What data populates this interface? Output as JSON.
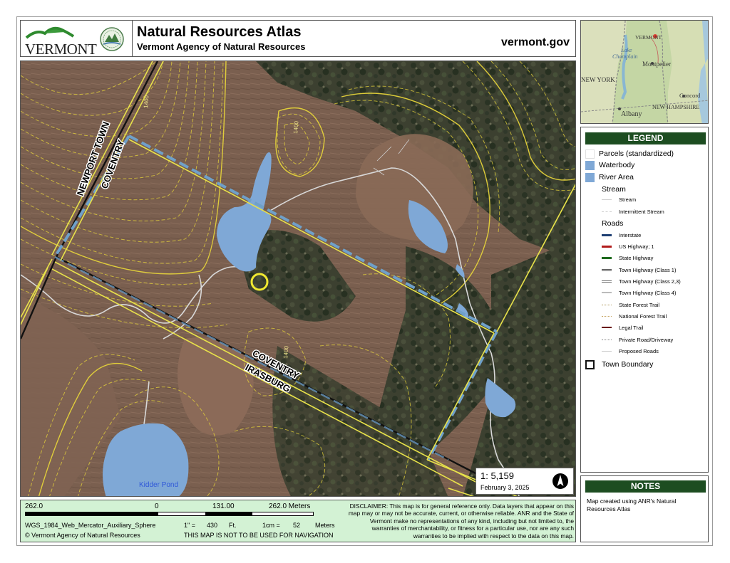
{
  "header": {
    "logo_text": "VERMONT",
    "title": "Natural Resources Atlas",
    "subtitle": "Vermont Agency of Natural Resources",
    "site": "vermont.gov"
  },
  "map": {
    "town_labels": {
      "newport": "NEWPORT TOWN",
      "coventry_north": "COVENTRY",
      "coventry_south": "COVENTRY",
      "irasburg": "IRASBURG"
    },
    "pond_label": "Kidder Pond",
    "contour_labels": [
      "1400",
      "1400",
      "1400"
    ],
    "scale_ratio": "1:  5,159",
    "date": "February 3, 2025",
    "colors": {
      "water": "#7fa8d6",
      "contour": "#e5d33a",
      "boundary": "#111111",
      "parcel": "#e8e24a",
      "town_cased": "#6fa0c9",
      "stream": "#d8d8d8"
    }
  },
  "locator": {
    "labels": {
      "vermont": "VERMONT",
      "lake": "Lake\nChamplain",
      "montpelier": "Montpelier",
      "new_york": "NEW YORK",
      "new_hampshire": "NEW HAMPSHIRE",
      "concord": "Concord",
      "albany": "Albany"
    }
  },
  "legend": {
    "title": "LEGEND",
    "items": {
      "parcels": "Parcels (standardized)",
      "waterbody": "Waterbody",
      "river_area": "River Area",
      "stream_group": "Stream",
      "stream": "Stream",
      "intermittent": "Intermittent Stream",
      "roads_group": "Roads",
      "interstate": "Interstate",
      "us_highway": "US Highway; 1",
      "state_highway": "State Highway",
      "town_hwy_1": "Town Highway (Class 1)",
      "town_hwy_23": "Town Highway (Class 2,3)",
      "town_hwy_4": "Town Highway (Class 4)",
      "state_forest": "State Forest Trail",
      "national_forest": "National Forest Trail",
      "legal_trail": "Legal Trail",
      "private_road": "Private Road/Driveway",
      "proposed_roads": "Proposed Roads",
      "town_boundary": "Town Boundary"
    },
    "colors": {
      "waterbody": "#7fa8d6",
      "river_area": "#7fa8d6",
      "interstate": "#1f3f73",
      "us_highway": "#b11c1c",
      "state_highway": "#1f6b1f",
      "legal_trail": "#6a1818"
    }
  },
  "notes": {
    "title": "NOTES",
    "text": "Map created using ANR's Natural Resources Atlas"
  },
  "footer": {
    "scale_left": "262.0",
    "scale_zero": "0",
    "scale_mid": "131.00",
    "scale_right": "262.0 Meters",
    "projection": "WGS_1984_Web_Mercator_Auxiliary_Sphere",
    "copyright": "© Vermont Agency of Natural Resources",
    "inch_label": "1\" =",
    "inch_value": "430",
    "inch_unit": "Ft.",
    "cm_label": "1cm =",
    "cm_value": "52",
    "cm_unit": "Meters",
    "nav_warning": "THIS MAP IS NOT TO BE USED FOR NAVIGATION",
    "disclaimer": "DISCLAIMER: This map is for general reference only. Data layers that appear on this map may or may not be accurate, current, or otherwise reliable. ANR and the State of Vermont make no representations of any kind, including but not limited to, the warranties of merchantability, or fitness for a particular use, nor are any such warranties to be implied with respect to the data on this map."
  }
}
